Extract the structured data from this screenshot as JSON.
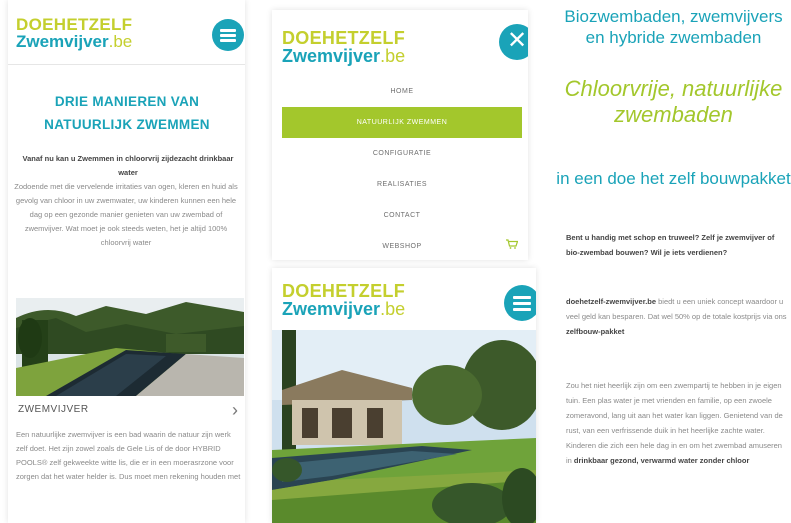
{
  "brand": {
    "line1": "DOEHETZELF",
    "line2": "Zwemvijver",
    "suffix": ".be",
    "green": "#c4cf2e",
    "teal": "#1aa3b8"
  },
  "panel1": {
    "heading": "DRIE MANIEREN VAN NATUURLIJK ZWEMMEN",
    "intro_bold": "Vanaf nu kan u Zwemmen in chloorvrij zijdezacht drinkbaar water",
    "intro": "Zodoende met die vervelende irritaties van ogen, kleren en huid als gevolg van chloor in uw zwemwater, uw kinderen kunnen een hele dag op een gezonde manier genieten van uw zwembad of zwemvijver. Wat moet je ook steeds weten, het je altijd 100% chloorvrij water",
    "section_title": "ZWEMVIJVER",
    "chevron": "›",
    "body": "Een natuurlijke zwemvijver is een bad waarin de natuur zijn werk zelf doet. Het zijn zowel zoals de Gele Lis of de door HYBRID POOLS® zelf gekweekte witte lis, die er in een moerasrzone voor zorgen dat het water helder is. Dus moet men rekening houden met"
  },
  "menu": {
    "items": [
      {
        "label": "HOME",
        "active": false
      },
      {
        "label": "NATUURLIJK ZWEMMEN",
        "active": true
      },
      {
        "label": "CONFIGURATIE",
        "active": false
      },
      {
        "label": "REALISATIES",
        "active": false
      },
      {
        "label": "CONTACT",
        "active": false
      },
      {
        "label": "WEBSHOP",
        "active": false
      }
    ],
    "close_glyph": "✕",
    "cart_glyph": "🛒",
    "accent": "#a3c72c"
  },
  "panel4": {
    "title_top": "Biozwembaden, zwemvijvers en hybride zwembaden",
    "title_mid": "Chloorvrije, natuurlijke zwembaden",
    "title_bottom": "in een doe het zelf bouwpakket",
    "question": "Bent u handig met schop en truweel? Zelf je zwemvijver of bio-zwembad bouwen? Wil je iets verdienen?",
    "para1_brand": "doehetzelf-zwemvijver.be",
    "para1_text": " biedt u een uniek concept waardoor u veel geld kan besparen. Dat wel 50% op de totale kostprijs via ons ",
    "para1_bold": "zelfbouw-pakket",
    "para2_text": "Zou het niet heerlijk zijn om een zwempartij te hebben in je eigen tuin. Een plas water je met vrienden en familie, op een zwoele zomeravond, lang uit aan het water kan liggen. Genietend van de rust, van een verfrissende duik in het heerlijke zachte water. Kinderen die zich een hele dag in en om het zwembad amuseren in ",
    "para2_bold": "drinkbaar gezond, verwarmd water zonder chloor"
  }
}
